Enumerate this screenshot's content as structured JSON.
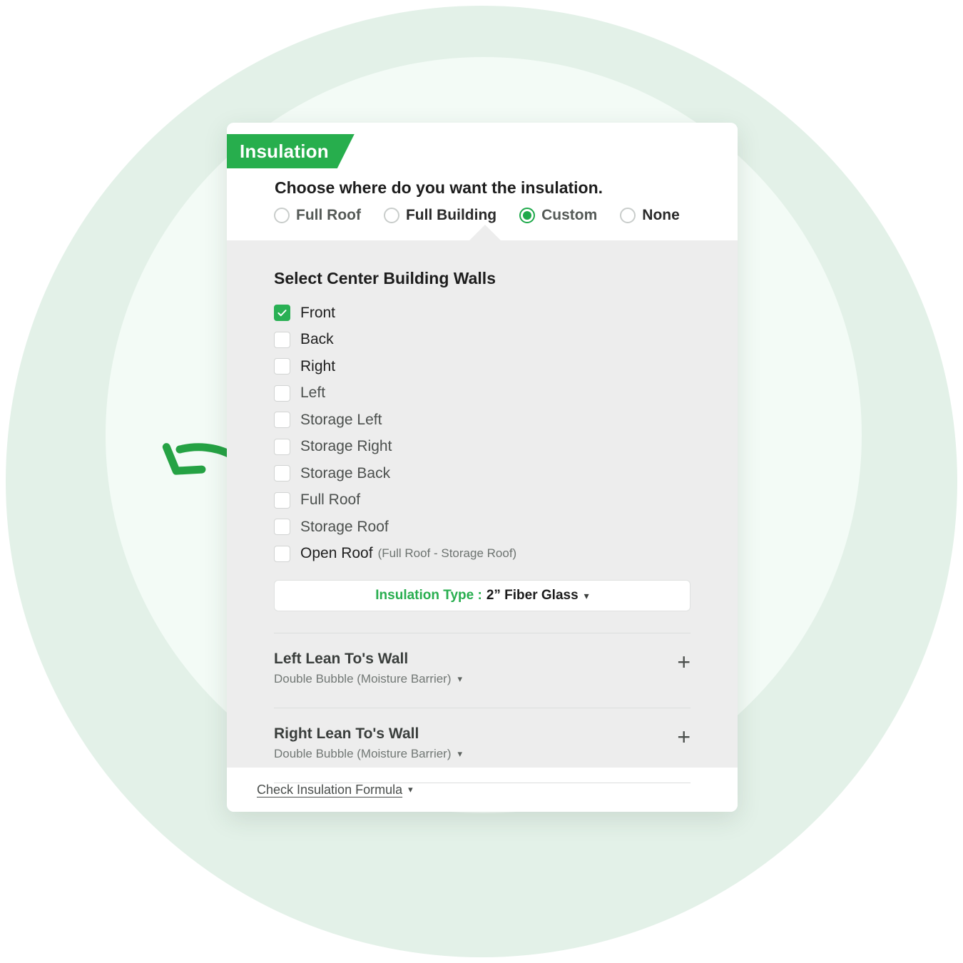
{
  "card": {
    "badge_label": "Insulation",
    "question": "Choose where do you want the insulation.",
    "mode_options": [
      {
        "label": "Full Roof",
        "selected": false
      },
      {
        "label": "Full Building",
        "selected": false
      },
      {
        "label": "Custom",
        "selected": true
      },
      {
        "label": "None",
        "selected": false
      }
    ],
    "section_title": "Select Center Building Walls",
    "walls": [
      {
        "label": "Front",
        "checked": true,
        "note": ""
      },
      {
        "label": "Back",
        "checked": false,
        "note": ""
      },
      {
        "label": "Right",
        "checked": false,
        "note": ""
      },
      {
        "label": "Left",
        "checked": false,
        "note": ""
      },
      {
        "label": "Storage Left",
        "checked": false,
        "note": ""
      },
      {
        "label": "Storage Right",
        "checked": false,
        "note": ""
      },
      {
        "label": "Storage Back",
        "checked": false,
        "note": ""
      },
      {
        "label": "Full Roof",
        "checked": false,
        "note": ""
      },
      {
        "label": "Storage Roof",
        "checked": false,
        "note": ""
      },
      {
        "label": "Open Roof",
        "checked": false,
        "note": "(Full Roof - Storage Roof)"
      }
    ],
    "insulation_type": {
      "label": "Insulation Type :",
      "value": "2” Fiber Glass",
      "caret": "chevron-down-icon"
    },
    "lean_sections": [
      {
        "title": "Left Lean To's Wall",
        "material": "Double Bubble (Moisture Barrier)",
        "expand": "+"
      },
      {
        "title": "Right Lean To's Wall",
        "material": "Double Bubble (Moisture Barrier)",
        "expand": "+"
      }
    ],
    "footer": {
      "link_label": "Check Insulation Formula",
      "caret": "chevron-down-icon"
    }
  },
  "colors": {
    "brand_green": "#27ae4d",
    "checkbox_green": "#29b054",
    "body_gray": "#ededed",
    "bg_circle_outer": "#e3f1e8",
    "bg_circle_inner": "#f3fbf6",
    "arrow_green": "#25a244"
  },
  "annotation": {
    "name": "curved-left-arrow"
  }
}
